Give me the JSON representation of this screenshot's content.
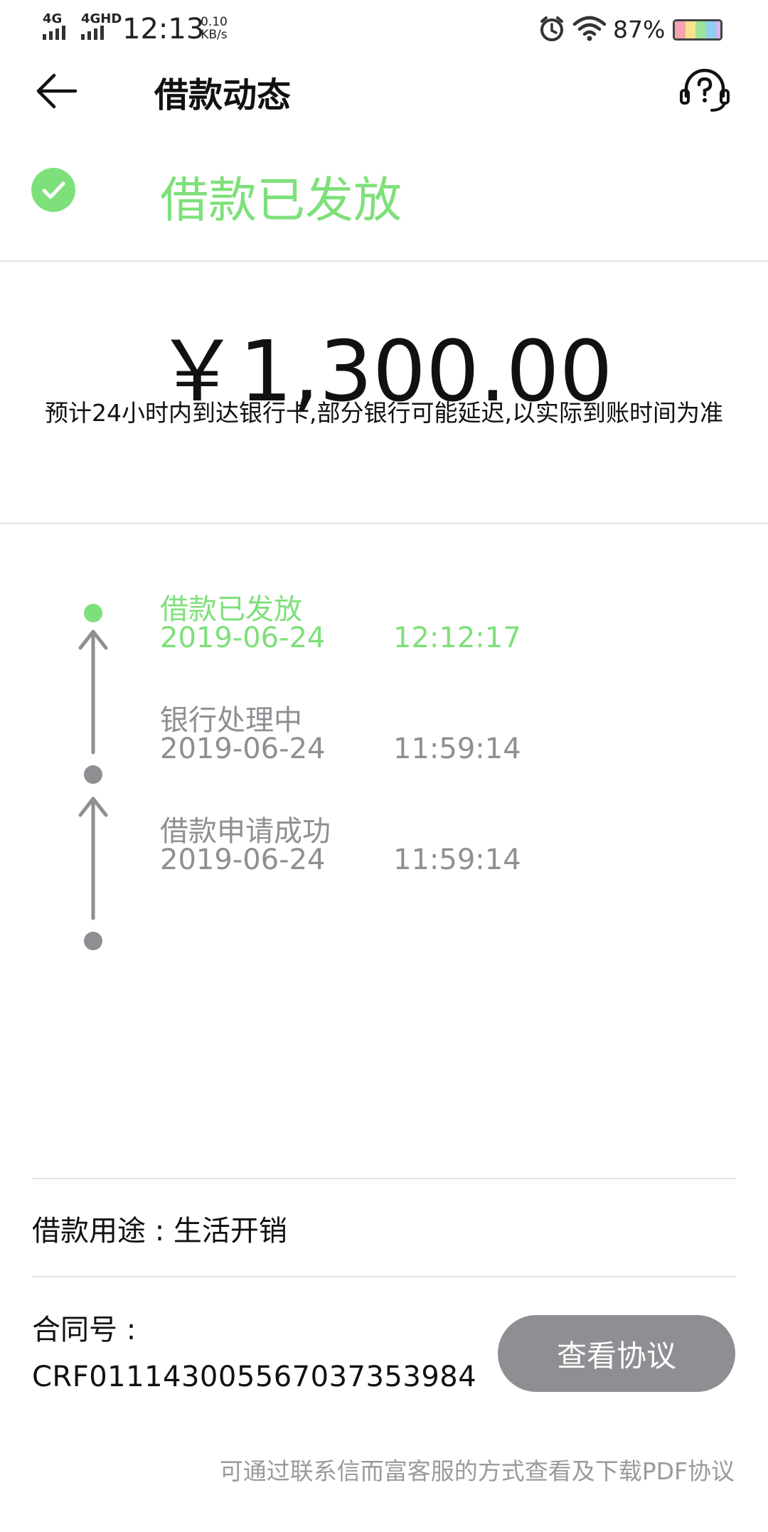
{
  "status_bar": {
    "sig1": "4G",
    "sig2": "4GHD",
    "time": "12:13",
    "speed_value": "0.10",
    "speed_unit": "KB/s",
    "battery": "87%"
  },
  "header": {
    "title": "借款动态",
    "back_icon": "arrow-left-icon",
    "help_icon": "headset-question-icon"
  },
  "status": {
    "text": "借款已发放",
    "color": "#7ee07a"
  },
  "amount": {
    "value": "￥1,300.00",
    "note": "预计24小时内到达银行卡,部分银行可能延迟,以实际到账时间为准"
  },
  "timeline": [
    {
      "title": "借款已发放",
      "date": "2019-06-24",
      "time": "12:12:17",
      "active": true
    },
    {
      "title": "银行处理中",
      "date": "2019-06-24",
      "time": "11:59:14",
      "active": false
    },
    {
      "title": "借款申请成功",
      "date": "2019-06-24",
      "time": "11:59:14",
      "active": false
    }
  ],
  "details": {
    "usage": "借款用途 : 生活开销",
    "contract_label": "合同号 :",
    "contract_no": "CRF01114300556703735398​4",
    "view_button": "查看协议",
    "hint": "可通过联系信而富客服的方式查看及下载PDF协议"
  },
  "colors": {
    "accent": "#7ee07a",
    "grey": "#8e8e93"
  }
}
